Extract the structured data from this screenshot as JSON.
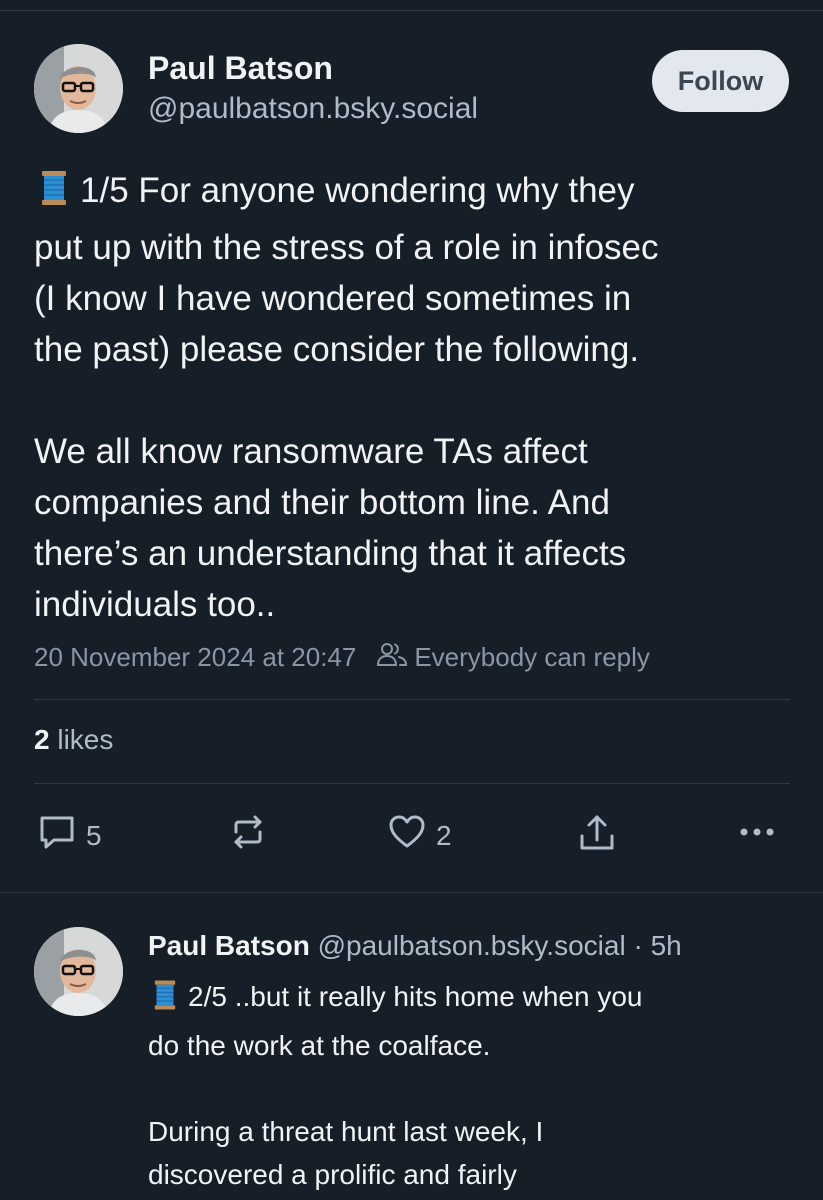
{
  "post": {
    "author": {
      "display_name": "Paul Batson",
      "handle": "@paulbatson.bsky.social"
    },
    "follow_label": "Follow",
    "thread_icon": "spool-of-thread-icon",
    "body_lines": [
      "1/5 For anyone wondering why they",
      "put up with the stress of a role in infosec",
      "(I know I have wondered sometimes in",
      "the past) please consider the following.",
      "",
      "We all know ransomware TAs affect",
      "companies and their bottom line. And",
      "there’s an understanding that it affects",
      "individuals too.."
    ],
    "timestamp": "20 November 2024 at 20:47",
    "reply_setting": "Everybody can reply",
    "likes_count": "2",
    "likes_label": "likes",
    "actions": {
      "reply_count": "5",
      "like_count": "2"
    }
  },
  "reply": {
    "author": {
      "display_name": "Paul Batson",
      "handle": "@paulbatson.bsky.social",
      "separator": "·",
      "age": "5h"
    },
    "body_lines": [
      "2/5 ..but it really hits home when you",
      "do the work at the coalface.",
      "",
      "During a threat hunt last week, I",
      "discovered a prolific and fairly"
    ]
  },
  "colors": {
    "background": "#161e27",
    "text_primary": "#f1f3f5",
    "text_secondary": "#aebbc9",
    "follow_bg": "#e3e8ee",
    "spool_thread": "#2b8fd6"
  }
}
